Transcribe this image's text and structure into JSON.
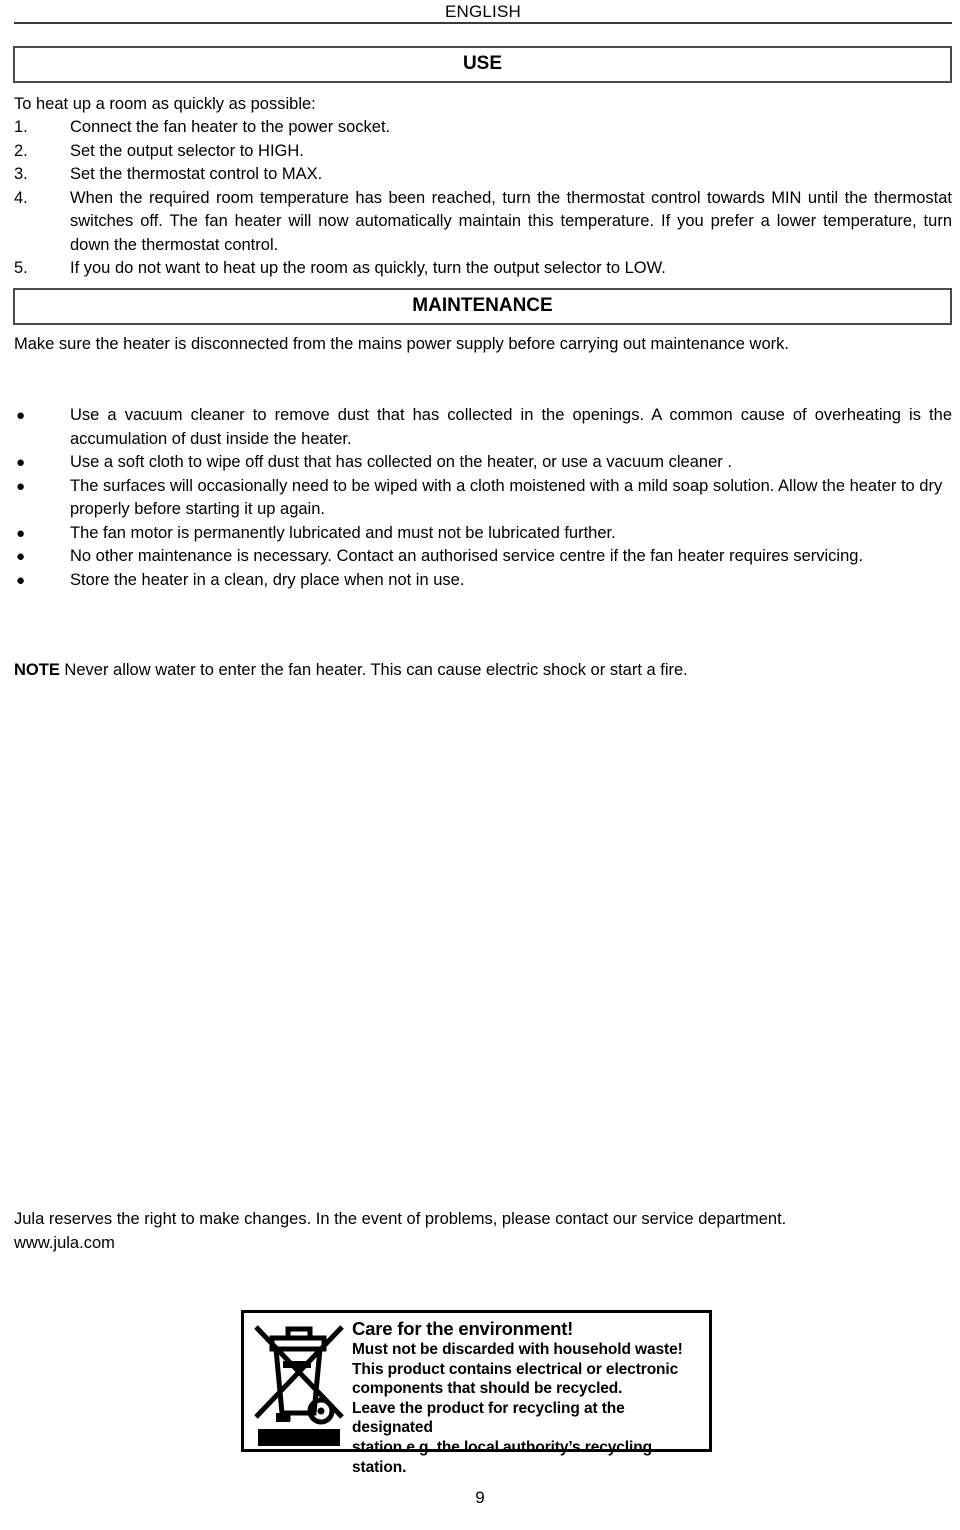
{
  "header": {
    "language": "ENGLISH"
  },
  "sections": {
    "use": {
      "title": "USE",
      "intro": "To heat up a room as quickly as possible:",
      "steps": [
        {
          "marker": "1.",
          "text": "Connect the fan heater to the power socket."
        },
        {
          "marker": "2.",
          "text": "Set the output selector to HIGH."
        },
        {
          "marker": "3.",
          "text": "Set the thermostat control to MAX."
        },
        {
          "marker": "4.",
          "text": "When the required room temperature has been reached, turn the thermostat control towards MIN until the thermostat switches off. The fan heater will now automatically maintain this temperature. If you prefer a lower temperature, turn down the thermostat control."
        },
        {
          "marker": "5.",
          "text": "If you do not want to heat up the room as quickly, turn the output selector to LOW."
        }
      ]
    },
    "maintenance": {
      "title": "MAINTENANCE",
      "intro": "Make sure the heater is disconnected from the mains power supply before carrying out maintenance work.",
      "bullet": "●",
      "items": [
        "Use a vacuum cleaner to remove dust that has collected in the openings. A common cause of overheating is the accumulation of dust inside the heater.",
        "Use a soft cloth to wipe off dust that has collected on the heater, or use a vacuum cleaner .",
        "The surfaces will occasionally need to be wiped with a cloth moistened with a mild soap solution. Allow the heater to dry properly before starting it up again.",
        "The fan motor is permanently lubricated and must not be lubricated further.",
        "No other maintenance is necessary. Contact an authorised service centre if the fan heater requires servicing.",
        "Store the heater in a clean, dry place when not in use."
      ],
      "note_label": "NOTE",
      "note_text": " Never allow water to enter the fan heater. This can cause electric shock or start a fire."
    }
  },
  "footer": {
    "disclaimer": "Jula reserves the right to make changes. In the event of problems, please contact our service department.",
    "website": "www.jula.com",
    "page_number": "9"
  },
  "environment_notice": {
    "title": "Care for the environment!",
    "line1": "Must not be discarded with household waste!",
    "line2": "This product contains electrical or electronic",
    "line3": "components that should be recycled.",
    "line4": "Leave the product for recycling at the designated",
    "line5": "station e.g. the local authority’s recycling station."
  }
}
